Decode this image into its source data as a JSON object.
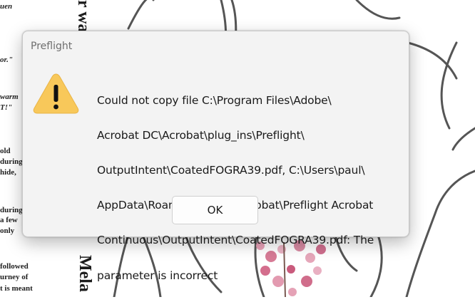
{
  "dialog": {
    "title": "Preflight",
    "icon": "warning-icon",
    "icon_color": "#F8C85A",
    "message_lines": [
      "Could not copy file C:\\Program Files\\Adobe\\",
      "Acrobat DC\\Acrobat\\plug_ins\\Preflight\\",
      "OutputIntent\\CoatedFOGRA39.pdf, C:\\Users\\paul\\",
      "AppData\\Roaming\\Adobe\\Acrobat\\Preflight Acrobat",
      "Continuous\\OutputIntent\\CoatedFOGRA39.pdf: The",
      "parameter is incorrect"
    ],
    "ok_label": "OK"
  },
  "background": {
    "fragments": [
      "uen",
      "or.\"",
      "warm",
      "T!\"",
      "old",
      "during",
      "hide,",
      "during",
      "a few",
      "only",
      "followed",
      "urney of",
      "t is meant"
    ],
    "vertical_top": "r wa",
    "vertical_bottom": "Mela"
  }
}
